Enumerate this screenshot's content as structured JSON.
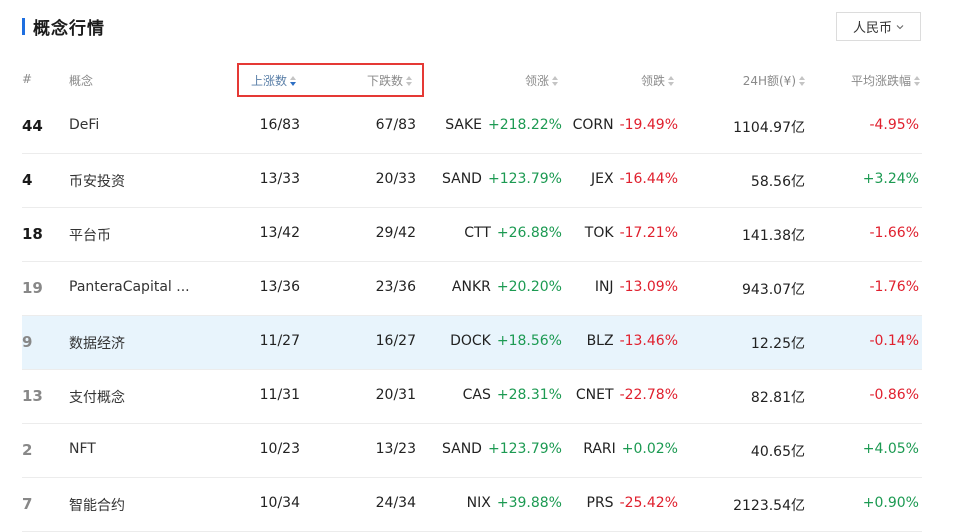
{
  "title": "概念行情",
  "currency": {
    "label": "人民币"
  },
  "columns": {
    "rank": "#",
    "name": "概念",
    "up": "上涨数",
    "down": "下跌数",
    "gain_leader": "领涨",
    "lose_leader": "领跌",
    "volume": "24H额(¥)",
    "avg": "平均涨跌幅"
  },
  "rows": [
    {
      "rank": "44",
      "name": "DeFi",
      "up": "16/83",
      "down": "67/83",
      "gain_sym": "SAKE",
      "gain_pct": "+218.22%",
      "lose_sym": "CORN",
      "lose_pct": "-19.49%",
      "volume": "1104.97亿",
      "avg": "-4.95%"
    },
    {
      "rank": "4",
      "name": "币安投资",
      "up": "13/33",
      "down": "20/33",
      "gain_sym": "SAND",
      "gain_pct": "+123.79%",
      "lose_sym": "JEX",
      "lose_pct": "-16.44%",
      "volume": "58.56亿",
      "avg": "+3.24%"
    },
    {
      "rank": "18",
      "name": "平台币",
      "up": "13/42",
      "down": "29/42",
      "gain_sym": "CTT",
      "gain_pct": "+26.88%",
      "lose_sym": "TOK",
      "lose_pct": "-17.21%",
      "volume": "141.38亿",
      "avg": "-1.66%"
    },
    {
      "rank": "19",
      "name": "PanteraCapital ...",
      "up": "13/36",
      "down": "23/36",
      "gain_sym": "ANKR",
      "gain_pct": "+20.20%",
      "lose_sym": "INJ",
      "lose_pct": "-13.09%",
      "volume": "943.07亿",
      "avg": "-1.76%"
    },
    {
      "rank": "9",
      "name": "数据经济",
      "up": "11/27",
      "down": "16/27",
      "gain_sym": "DOCK",
      "gain_pct": "+18.56%",
      "lose_sym": "BLZ",
      "lose_pct": "-13.46%",
      "volume": "12.25亿",
      "avg": "-0.14%"
    },
    {
      "rank": "13",
      "name": "支付概念",
      "up": "11/31",
      "down": "20/31",
      "gain_sym": "CAS",
      "gain_pct": "+28.31%",
      "lose_sym": "CNET",
      "lose_pct": "-22.78%",
      "volume": "82.81亿",
      "avg": "-0.86%"
    },
    {
      "rank": "2",
      "name": "NFT",
      "up": "10/23",
      "down": "13/23",
      "gain_sym": "SAND",
      "gain_pct": "+123.79%",
      "lose_sym": "RARI",
      "lose_pct": "+0.02%",
      "volume": "40.65亿",
      "avg": "+4.05%"
    },
    {
      "rank": "7",
      "name": "智能合约",
      "up": "10/34",
      "down": "24/34",
      "gain_sym": "NIX",
      "gain_pct": "+39.88%",
      "lose_sym": "PRS",
      "lose_pct": "-25.42%",
      "volume": "2123.54亿",
      "avg": "+0.90%"
    }
  ],
  "colors": {
    "accent": "#1e6fe0",
    "up": "#1c9a52",
    "down": "#e0202e",
    "highlight_row": "#e8f4fc",
    "highlight_box": "#e53935"
  },
  "icons": {
    "sort": "sort-arrows-icon",
    "dropdown": "chevron-down-icon"
  }
}
